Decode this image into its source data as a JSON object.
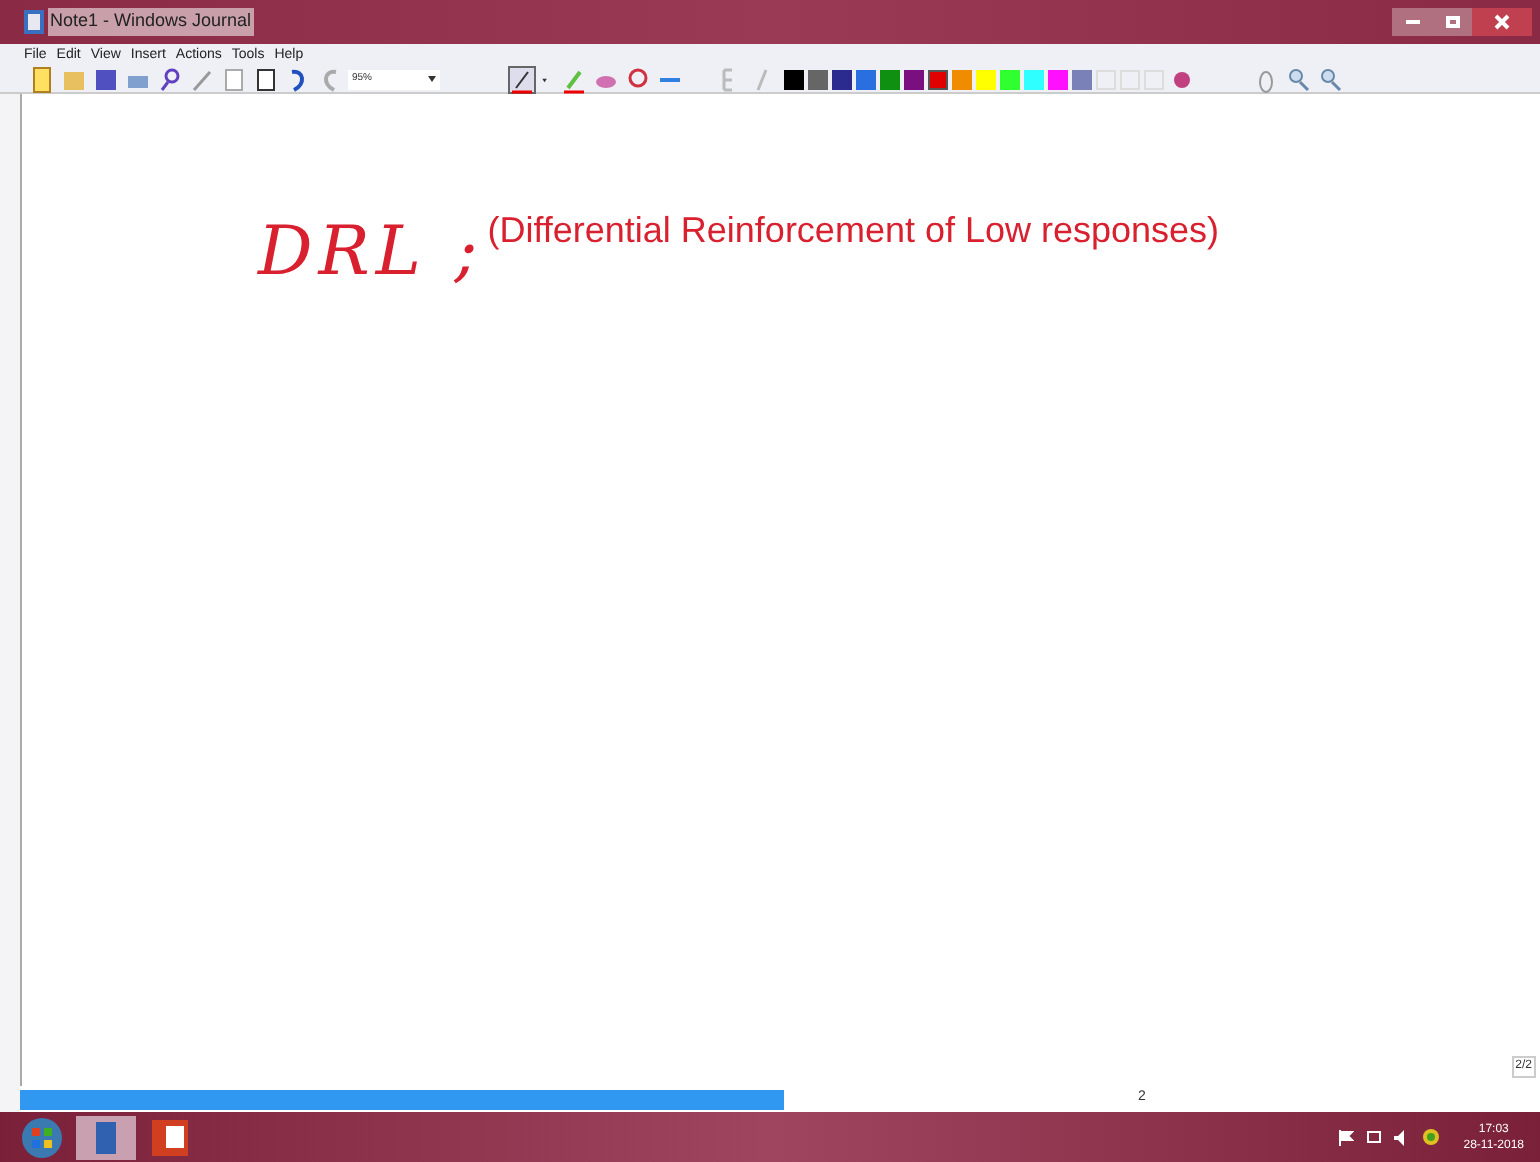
{
  "window": {
    "title": "Note1 - Windows Journal"
  },
  "menu": [
    "File",
    "Edit",
    "View",
    "Insert",
    "Actions",
    "Tools",
    "Help"
  ],
  "toolbar": {
    "zoom": "95%",
    "palette": [
      {
        "color": "#000000",
        "selected": false
      },
      {
        "color": "#666666",
        "selected": false
      },
      {
        "color": "#2b2b8f",
        "selected": false
      },
      {
        "color": "#2a6fe0",
        "selected": false
      },
      {
        "color": "#109010",
        "selected": false
      },
      {
        "color": "#7a1080",
        "selected": false
      },
      {
        "color": "#e00000",
        "selected": true
      },
      {
        "color": "#f08c00",
        "selected": false
      },
      {
        "color": "#ffff00",
        "selected": false
      },
      {
        "color": "#30ff30",
        "selected": false
      },
      {
        "color": "#30ffff",
        "selected": false
      },
      {
        "color": "#ff10ff",
        "selected": false
      },
      {
        "color": "#7a80b8",
        "selected": false
      }
    ]
  },
  "note": {
    "ink": "DRL ;",
    "text": "(Differential Reinforcement of Low responses)"
  },
  "page_indicator": "2/2",
  "page_number": "2",
  "taskbar": {
    "time": "17:03",
    "date": "28-11-2018"
  }
}
